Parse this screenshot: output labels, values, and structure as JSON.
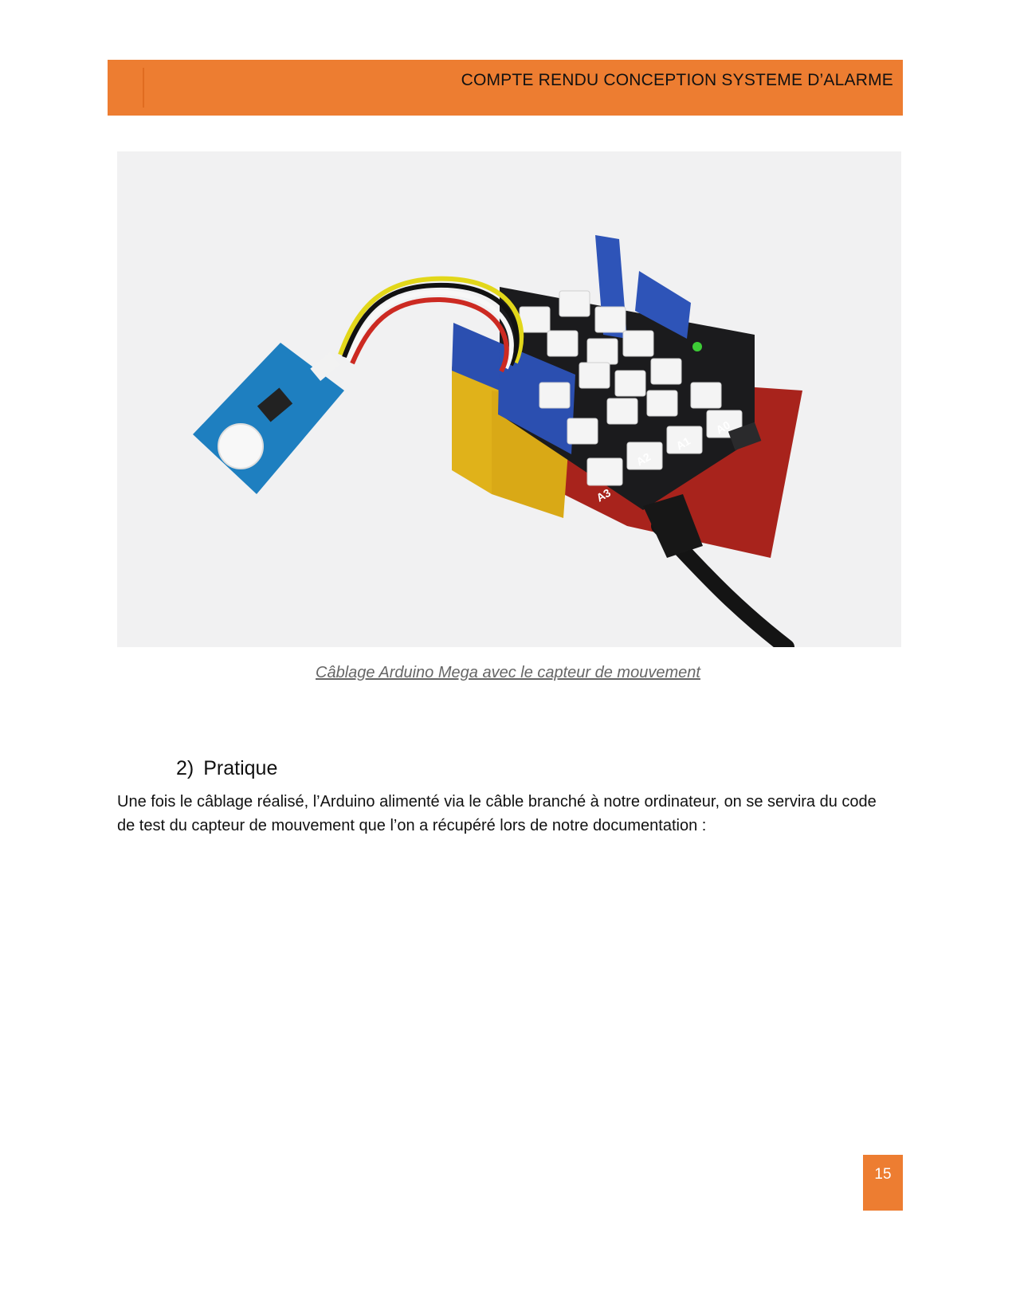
{
  "header": {
    "title": "COMPTE RENDU CONCEPTION SYSTEME D’ALARME"
  },
  "figure": {
    "caption": "Câblage Arduino Mega avec le capteur de mouvement",
    "port_labels": [
      "A0",
      "A1",
      "A2",
      "A3"
    ]
  },
  "section": {
    "number": "2)",
    "title": "Pratique",
    "body": "Une fois le câblage réalisé, l’Arduino alimenté via le câble branché à notre ordinateur, on se servira du code de test du capteur de mouvement que l’on a récupéré lors de notre documentation :"
  },
  "footer": {
    "page_number": "15"
  },
  "colors": {
    "accent": "#ED7D31"
  }
}
